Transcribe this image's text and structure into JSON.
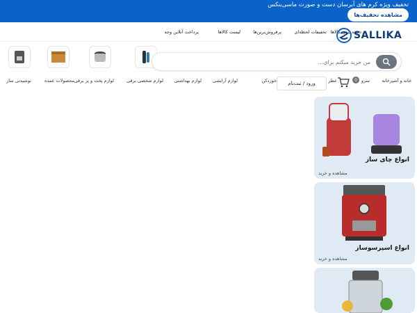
{
  "promo": {
    "text": "تخفیف ویژه کرم های آبرسان دست و صورت ماسی‌بنکس",
    "button_label": "مشاهده تخفیف‌ها"
  },
  "nav": {
    "links": [
      "دسته بندی کالاها",
      "تخفیفات لحظه‌ای",
      "پرفروش‌ترین‌ها",
      "لیست کالاها",
      "پرداخت آنلاین وجه"
    ]
  },
  "logo": {
    "text": "SALLIKA"
  },
  "search": {
    "placeholder": "من خرید میکنم برای..."
  },
  "categories": [
    "خانه و آشپزخانه",
    "سرو",
    "عطر ادکلن، اسپری، چای ساز و خوردکن",
    "لوازم آرایشی",
    "لوازم بهداشتی",
    "لوازم شخصی برقی",
    "لوازم پخت و پز برقی",
    "محصولات عمده",
    "نوشیدنی ساز"
  ],
  "cart": {
    "count": "0",
    "label": "ورود / ثبت‌نام"
  },
  "cards": [
    {
      "title": "انواع چای ساز",
      "cta": "مشاهده و خرید"
    },
    {
      "title": "انواع اسپرسوساز",
      "cta": "مشاهده و خرید"
    },
    {
      "title": "",
      "cta": ""
    }
  ],
  "colors": {
    "brand_blue": "#0a63c9",
    "card_bg": "#dfeaf5",
    "search_btn": "#6b7480"
  }
}
